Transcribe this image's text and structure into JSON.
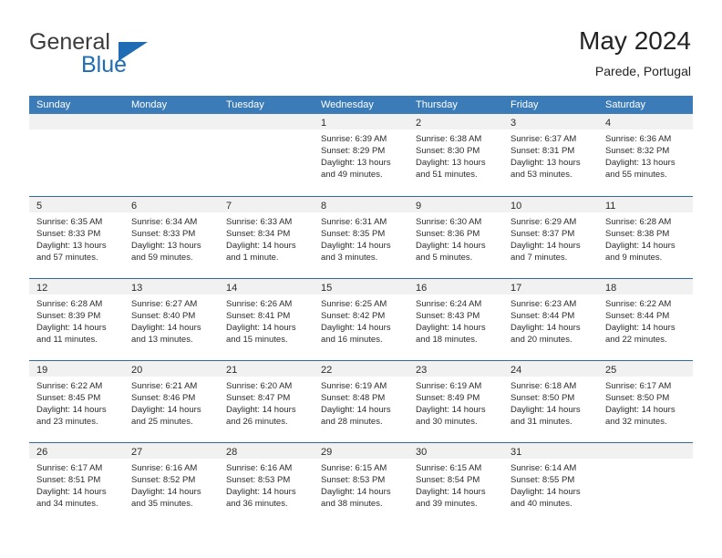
{
  "brand": {
    "name_part1": "General",
    "name_part2": "Blue",
    "triangle_icon": "triangle-icon",
    "accent_color": "#1f6cb4"
  },
  "header": {
    "title": "May 2024",
    "subtitle": "Parede, Portugal"
  },
  "theme": {
    "header_row_bg": "#3b7cb8",
    "row_divider": "#2d6ca8",
    "day_band_bg": "#f1f1f1",
    "text_color": "#2b2b2b"
  },
  "weekdays": [
    "Sunday",
    "Monday",
    "Tuesday",
    "Wednesday",
    "Thursday",
    "Friday",
    "Saturday"
  ],
  "weeks": [
    [
      {
        "day": "",
        "empty": true,
        "sunrise": "",
        "sunset": "",
        "daylight1": "",
        "daylight2": ""
      },
      {
        "day": "",
        "empty": true,
        "sunrise": "",
        "sunset": "",
        "daylight1": "",
        "daylight2": ""
      },
      {
        "day": "",
        "empty": true,
        "sunrise": "",
        "sunset": "",
        "daylight1": "",
        "daylight2": ""
      },
      {
        "day": "1",
        "empty": false,
        "sunrise": "Sunrise: 6:39 AM",
        "sunset": "Sunset: 8:29 PM",
        "daylight1": "Daylight: 13 hours",
        "daylight2": "and 49 minutes."
      },
      {
        "day": "2",
        "empty": false,
        "sunrise": "Sunrise: 6:38 AM",
        "sunset": "Sunset: 8:30 PM",
        "daylight1": "Daylight: 13 hours",
        "daylight2": "and 51 minutes."
      },
      {
        "day": "3",
        "empty": false,
        "sunrise": "Sunrise: 6:37 AM",
        "sunset": "Sunset: 8:31 PM",
        "daylight1": "Daylight: 13 hours",
        "daylight2": "and 53 minutes."
      },
      {
        "day": "4",
        "empty": false,
        "sunrise": "Sunrise: 6:36 AM",
        "sunset": "Sunset: 8:32 PM",
        "daylight1": "Daylight: 13 hours",
        "daylight2": "and 55 minutes."
      }
    ],
    [
      {
        "day": "5",
        "empty": false,
        "sunrise": "Sunrise: 6:35 AM",
        "sunset": "Sunset: 8:33 PM",
        "daylight1": "Daylight: 13 hours",
        "daylight2": "and 57 minutes."
      },
      {
        "day": "6",
        "empty": false,
        "sunrise": "Sunrise: 6:34 AM",
        "sunset": "Sunset: 8:33 PM",
        "daylight1": "Daylight: 13 hours",
        "daylight2": "and 59 minutes."
      },
      {
        "day": "7",
        "empty": false,
        "sunrise": "Sunrise: 6:33 AM",
        "sunset": "Sunset: 8:34 PM",
        "daylight1": "Daylight: 14 hours",
        "daylight2": "and 1 minute."
      },
      {
        "day": "8",
        "empty": false,
        "sunrise": "Sunrise: 6:31 AM",
        "sunset": "Sunset: 8:35 PM",
        "daylight1": "Daylight: 14 hours",
        "daylight2": "and 3 minutes."
      },
      {
        "day": "9",
        "empty": false,
        "sunrise": "Sunrise: 6:30 AM",
        "sunset": "Sunset: 8:36 PM",
        "daylight1": "Daylight: 14 hours",
        "daylight2": "and 5 minutes."
      },
      {
        "day": "10",
        "empty": false,
        "sunrise": "Sunrise: 6:29 AM",
        "sunset": "Sunset: 8:37 PM",
        "daylight1": "Daylight: 14 hours",
        "daylight2": "and 7 minutes."
      },
      {
        "day": "11",
        "empty": false,
        "sunrise": "Sunrise: 6:28 AM",
        "sunset": "Sunset: 8:38 PM",
        "daylight1": "Daylight: 14 hours",
        "daylight2": "and 9 minutes."
      }
    ],
    [
      {
        "day": "12",
        "empty": false,
        "sunrise": "Sunrise: 6:28 AM",
        "sunset": "Sunset: 8:39 PM",
        "daylight1": "Daylight: 14 hours",
        "daylight2": "and 11 minutes."
      },
      {
        "day": "13",
        "empty": false,
        "sunrise": "Sunrise: 6:27 AM",
        "sunset": "Sunset: 8:40 PM",
        "daylight1": "Daylight: 14 hours",
        "daylight2": "and 13 minutes."
      },
      {
        "day": "14",
        "empty": false,
        "sunrise": "Sunrise: 6:26 AM",
        "sunset": "Sunset: 8:41 PM",
        "daylight1": "Daylight: 14 hours",
        "daylight2": "and 15 minutes."
      },
      {
        "day": "15",
        "empty": false,
        "sunrise": "Sunrise: 6:25 AM",
        "sunset": "Sunset: 8:42 PM",
        "daylight1": "Daylight: 14 hours",
        "daylight2": "and 16 minutes."
      },
      {
        "day": "16",
        "empty": false,
        "sunrise": "Sunrise: 6:24 AM",
        "sunset": "Sunset: 8:43 PM",
        "daylight1": "Daylight: 14 hours",
        "daylight2": "and 18 minutes."
      },
      {
        "day": "17",
        "empty": false,
        "sunrise": "Sunrise: 6:23 AM",
        "sunset": "Sunset: 8:44 PM",
        "daylight1": "Daylight: 14 hours",
        "daylight2": "and 20 minutes."
      },
      {
        "day": "18",
        "empty": false,
        "sunrise": "Sunrise: 6:22 AM",
        "sunset": "Sunset: 8:44 PM",
        "daylight1": "Daylight: 14 hours",
        "daylight2": "and 22 minutes."
      }
    ],
    [
      {
        "day": "19",
        "empty": false,
        "sunrise": "Sunrise: 6:22 AM",
        "sunset": "Sunset: 8:45 PM",
        "daylight1": "Daylight: 14 hours",
        "daylight2": "and 23 minutes."
      },
      {
        "day": "20",
        "empty": false,
        "sunrise": "Sunrise: 6:21 AM",
        "sunset": "Sunset: 8:46 PM",
        "daylight1": "Daylight: 14 hours",
        "daylight2": "and 25 minutes."
      },
      {
        "day": "21",
        "empty": false,
        "sunrise": "Sunrise: 6:20 AM",
        "sunset": "Sunset: 8:47 PM",
        "daylight1": "Daylight: 14 hours",
        "daylight2": "and 26 minutes."
      },
      {
        "day": "22",
        "empty": false,
        "sunrise": "Sunrise: 6:19 AM",
        "sunset": "Sunset: 8:48 PM",
        "daylight1": "Daylight: 14 hours",
        "daylight2": "and 28 minutes."
      },
      {
        "day": "23",
        "empty": false,
        "sunrise": "Sunrise: 6:19 AM",
        "sunset": "Sunset: 8:49 PM",
        "daylight1": "Daylight: 14 hours",
        "daylight2": "and 30 minutes."
      },
      {
        "day": "24",
        "empty": false,
        "sunrise": "Sunrise: 6:18 AM",
        "sunset": "Sunset: 8:50 PM",
        "daylight1": "Daylight: 14 hours",
        "daylight2": "and 31 minutes."
      },
      {
        "day": "25",
        "empty": false,
        "sunrise": "Sunrise: 6:17 AM",
        "sunset": "Sunset: 8:50 PM",
        "daylight1": "Daylight: 14 hours",
        "daylight2": "and 32 minutes."
      }
    ],
    [
      {
        "day": "26",
        "empty": false,
        "sunrise": "Sunrise: 6:17 AM",
        "sunset": "Sunset: 8:51 PM",
        "daylight1": "Daylight: 14 hours",
        "daylight2": "and 34 minutes."
      },
      {
        "day": "27",
        "empty": false,
        "sunrise": "Sunrise: 6:16 AM",
        "sunset": "Sunset: 8:52 PM",
        "daylight1": "Daylight: 14 hours",
        "daylight2": "and 35 minutes."
      },
      {
        "day": "28",
        "empty": false,
        "sunrise": "Sunrise: 6:16 AM",
        "sunset": "Sunset: 8:53 PM",
        "daylight1": "Daylight: 14 hours",
        "daylight2": "and 36 minutes."
      },
      {
        "day": "29",
        "empty": false,
        "sunrise": "Sunrise: 6:15 AM",
        "sunset": "Sunset: 8:53 PM",
        "daylight1": "Daylight: 14 hours",
        "daylight2": "and 38 minutes."
      },
      {
        "day": "30",
        "empty": false,
        "sunrise": "Sunrise: 6:15 AM",
        "sunset": "Sunset: 8:54 PM",
        "daylight1": "Daylight: 14 hours",
        "daylight2": "and 39 minutes."
      },
      {
        "day": "31",
        "empty": false,
        "sunrise": "Sunrise: 6:14 AM",
        "sunset": "Sunset: 8:55 PM",
        "daylight1": "Daylight: 14 hours",
        "daylight2": "and 40 minutes."
      },
      {
        "day": "",
        "empty": true,
        "sunrise": "",
        "sunset": "",
        "daylight1": "",
        "daylight2": ""
      }
    ]
  ]
}
